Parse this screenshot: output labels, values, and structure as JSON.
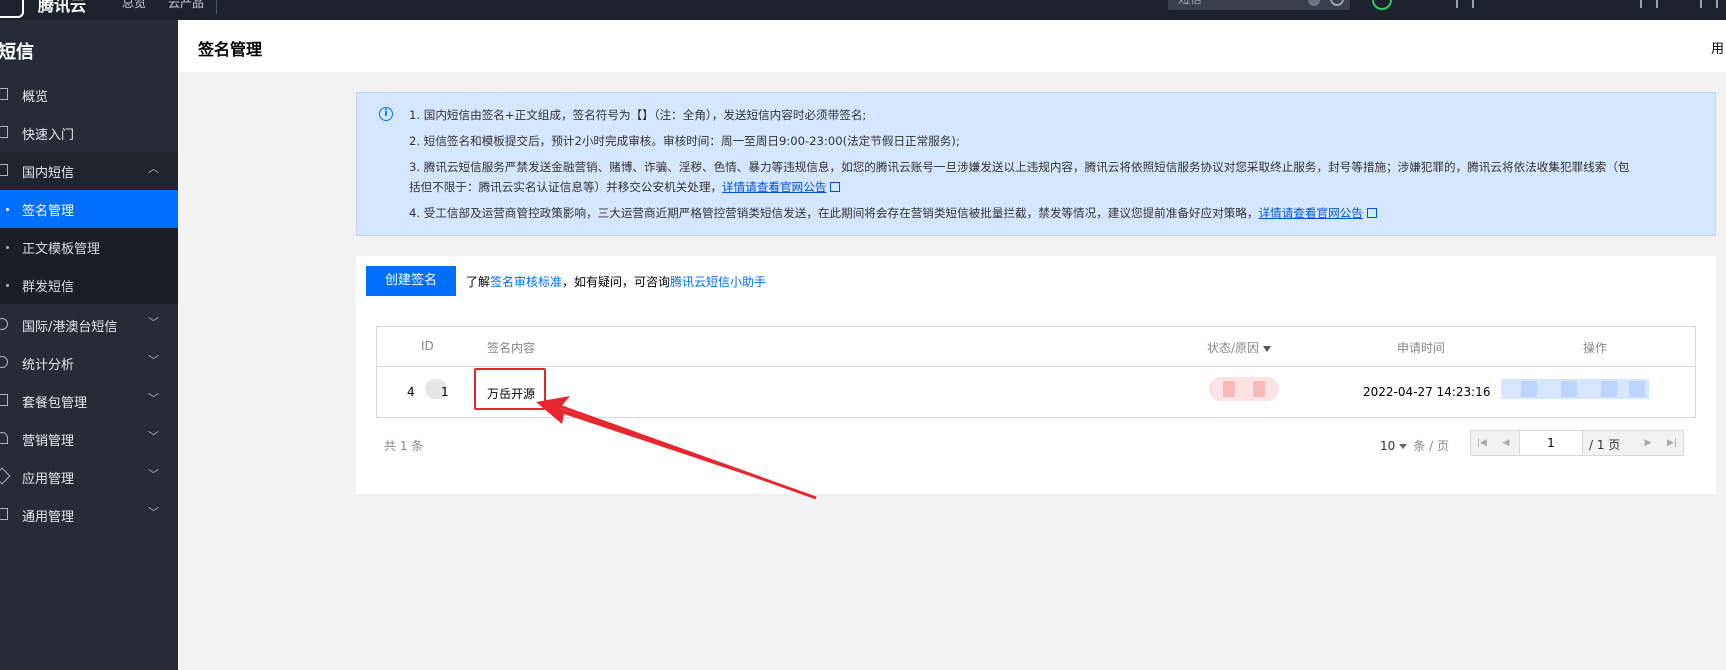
{
  "topbar": {
    "logo_text": "腾讯云",
    "nav_1": "总览",
    "nav_2": "云产品",
    "search_placeholder": "短信"
  },
  "sidebar": {
    "title": "短信",
    "items": [
      {
        "label": "概览"
      },
      {
        "label": "快速入门"
      },
      {
        "label": "国内短信"
      },
      {
        "label": "国际/港澳台短信"
      },
      {
        "label": "统计分析"
      },
      {
        "label": "套餐包管理"
      },
      {
        "label": "营销管理"
      },
      {
        "label": "应用管理"
      },
      {
        "label": "通用管理"
      }
    ],
    "sub_items": [
      {
        "label": "签名管理"
      },
      {
        "label": "正文模板管理"
      },
      {
        "label": "群发短信"
      }
    ]
  },
  "header": {
    "title": "签名管理",
    "right_text": "用"
  },
  "notice": {
    "line1": "1. 国内短信由签名+正文组成，签名符号为【】（注：全角），发送短信内容时必须带签名;",
    "line2": "2. 短信签名和模板提交后，预计2小时完成审核。审核时间：周一至周日9:00-23:00(法定节假日正常服务);",
    "line3a": "3. 腾讯云短信服务严禁发送金融营销、赌博、诈骗、淫秽、色情、暴力等违规信息，如您的腾讯云账号一旦涉嫌发送以上违规内容，腾讯云将依照短信服务协议对您采取终止服务，封号等措施；涉嫌犯罪的，腾讯云将依法收集犯罪线索（包",
    "line3b": "括但不限于：腾讯云实名认证信息等）并移交公安机关处理，",
    "line3_link": "详情请查看官网公告",
    "line4": "4. 受工信部及运营商管控政策影响，三大运营商近期严格管控营销类短信发送，在此期间将会存在营销类短信被批量拦截，禁发等情况，建议您提前准备好应对策略，",
    "line4_link": "详情请查看官网公告"
  },
  "toolbar": {
    "create_label": "创建签名",
    "hint_prefix": "了解",
    "hint_link1": "签名审核标准",
    "hint_middle": "，如有疑问，可咨询",
    "hint_link2": "腾讯云短信小助手"
  },
  "table": {
    "columns": {
      "id": "ID",
      "content": "签名内容",
      "status": "状态/原因",
      "time": "申请时间",
      "action": "操作"
    },
    "rows": [
      {
        "id_prefix": "4",
        "id_suffix": "1",
        "content": "万岳开源",
        "time": "2022-04-27 14:23:16"
      }
    ]
  },
  "footer": {
    "total": "共 1 条",
    "page_size": "10",
    "page_size_unit": "条 / 页",
    "page_current": "1",
    "page_total": "/ 1 页"
  },
  "colors": {
    "primary": "#006eff",
    "sidebar_bg": "#262c36",
    "topbar_bg": "#1c222c",
    "annotation_red": "#e8262f",
    "notice_bg": "#d5e7ff"
  }
}
